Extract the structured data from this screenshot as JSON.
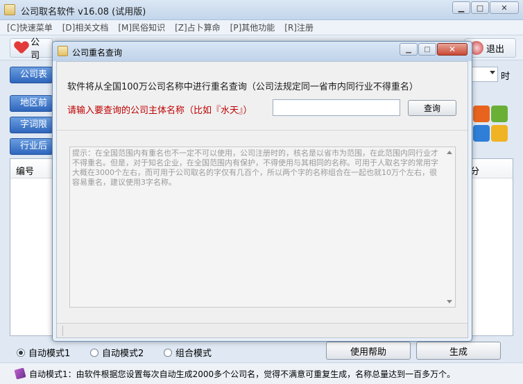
{
  "main": {
    "title": "公司取名软件 v16.08 (试用版)",
    "menu": [
      "[C]快速菜单",
      "[D]相关文档",
      "[M]民俗知识",
      "[Z]占卜算命",
      "[P]其他功能",
      "[R]注册"
    ],
    "toolbar": {
      "first_label": "公司",
      "exit_label": "退出"
    },
    "side_buttons": [
      "公司表",
      "地区前",
      "字词限",
      "行业后"
    ],
    "list": {
      "col_no": "编号",
      "col_score": "分"
    },
    "right_text": "时",
    "modes": {
      "mode1": "自动模式1",
      "mode2": "自动模式2",
      "mode3": "组合模式"
    },
    "help_button": "使用帮助",
    "generate_button": "生成",
    "status": "自动模式1：由软件根据您设置每次自动生成2000多个公司名，觉得不满意可重复生成，名称总量达到一百多万个。"
  },
  "dialog": {
    "title": "公司重名查询",
    "description": "软件将从全国100万公司名称中进行重名查询（公司法规定同一省市内同行业不得重名）",
    "prompt": "请输入要查询的公司主体名称（比如『水天』）",
    "input_value": "",
    "query_button": "查询",
    "hint": "提示：在全国范围内有重名也不一定不可以使用，公司注册时的，核名是以省市为范围，在此范围内同行业才不得重名。但是，对于知名企业，在全国范围内有保护，不得使用与其相同的名称。可用于人取名字的常用字大概在3000个左右，而可用于公司取名的字仅有几百个，所以两个字的名称组合在一起也就10万个左右，很容易重名，建议使用3字名称。"
  },
  "colors": {
    "prompt_red": "#c00000",
    "side_button_blue": "#2f66bd",
    "office_orange": "#e8641e",
    "office_green": "#6ab036",
    "office_blue": "#2f7fd8",
    "office_yellow": "#f0b323"
  }
}
